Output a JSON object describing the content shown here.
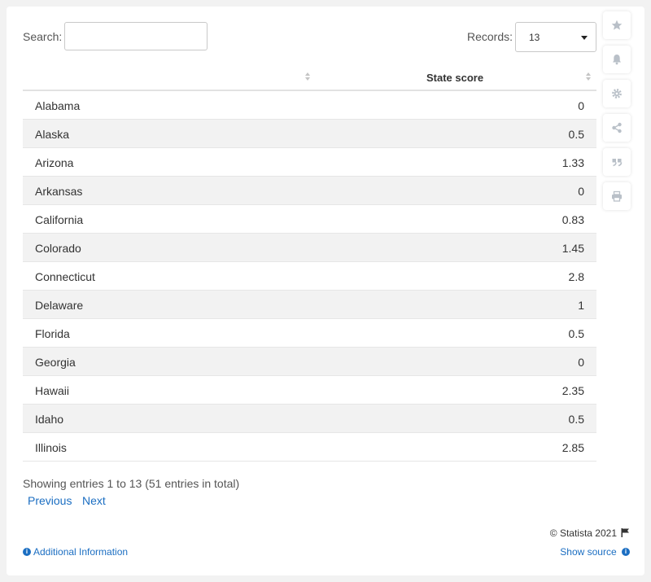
{
  "search": {
    "label": "Search:",
    "value": ""
  },
  "records": {
    "label": "Records:",
    "value": "13"
  },
  "table": {
    "columns": [
      "",
      "State score"
    ],
    "rows": [
      {
        "state": "Alabama",
        "score": "0"
      },
      {
        "state": "Alaska",
        "score": "0.5"
      },
      {
        "state": "Arizona",
        "score": "1.33"
      },
      {
        "state": "Arkansas",
        "score": "0"
      },
      {
        "state": "California",
        "score": "0.83"
      },
      {
        "state": "Colorado",
        "score": "1.45"
      },
      {
        "state": "Connecticut",
        "score": "2.8"
      },
      {
        "state": "Delaware",
        "score": "1"
      },
      {
        "state": "Florida",
        "score": "0.5"
      },
      {
        "state": "Georgia",
        "score": "0"
      },
      {
        "state": "Hawaii",
        "score": "2.35"
      },
      {
        "state": "Idaho",
        "score": "0.5"
      },
      {
        "state": "Illinois",
        "score": "2.85"
      }
    ]
  },
  "pagination": {
    "info": "Showing entries 1 to 13 (51 entries in total)",
    "previous": "Previous",
    "next": "Next"
  },
  "footer": {
    "copyright": "© Statista 2021",
    "additional_info": "Additional Information",
    "show_source": "Show source"
  },
  "tools": [
    "star-icon",
    "bell-icon",
    "gear-icon",
    "share-icon",
    "quote-icon",
    "print-icon"
  ],
  "colors": {
    "accent": "#1b6ec2",
    "row_alt": "#f2f2f2",
    "tool_icon": "#b9c0c8"
  }
}
